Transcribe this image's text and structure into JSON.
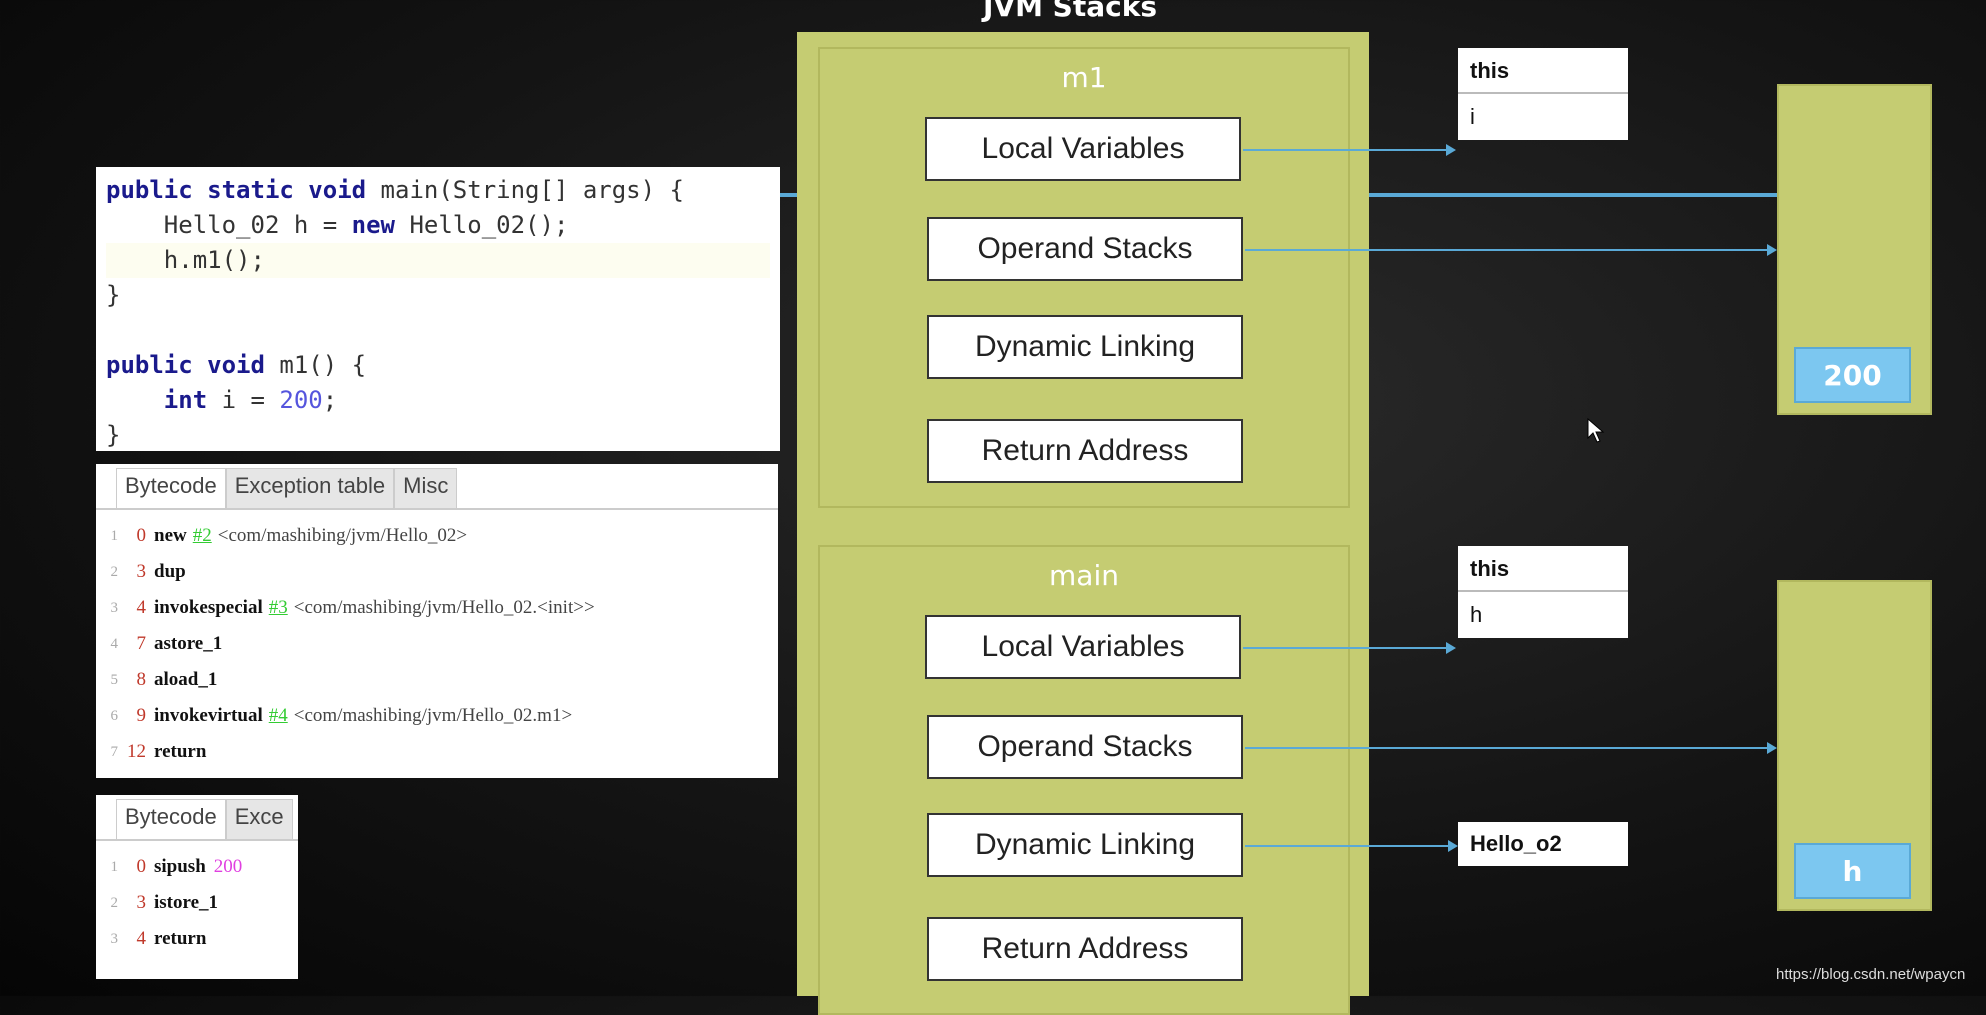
{
  "title": "JVM Stacks",
  "code": {
    "lines": [
      [
        {
          "t": "public static void",
          "c": "kw"
        },
        {
          "t": " main(String[] args) {"
        }
      ],
      [
        {
          "t": "    Hello_02 h = "
        },
        {
          "t": "new",
          "c": "kw"
        },
        {
          "t": " Hello_02();"
        }
      ],
      [
        {
          "t": "    h.m1();"
        }
      ],
      [
        {
          "t": "}"
        }
      ],
      [
        {
          "t": " "
        }
      ],
      [
        {
          "t": "public void",
          "c": "kw"
        },
        {
          "t": " m1() {"
        }
      ],
      [
        {
          "t": "    "
        },
        {
          "t": "int",
          "c": "kw"
        },
        {
          "t": " i = "
        },
        {
          "t": "200",
          "c": "num"
        },
        {
          "t": ";"
        }
      ],
      [
        {
          "t": "}"
        }
      ]
    ]
  },
  "bytecode_main": {
    "tabs": [
      "Bytecode",
      "Exception table",
      "Misc"
    ],
    "rows": [
      {
        "n": "1",
        "off": "0",
        "op": "new",
        "ref": "#2",
        "arg": "<com/mashibing/jvm/Hello_02>"
      },
      {
        "n": "2",
        "off": "3",
        "op": "dup"
      },
      {
        "n": "3",
        "off": "4",
        "op": "invokespecial",
        "ref": "#3",
        "arg": "<com/mashibing/jvm/Hello_02.<init>>"
      },
      {
        "n": "4",
        "off": "7",
        "op": "astore_1"
      },
      {
        "n": "5",
        "off": "8",
        "op": "aload_1"
      },
      {
        "n": "6",
        "off": "9",
        "op": "invokevirtual",
        "ref": "#4",
        "arg": "<com/mashibing/jvm/Hello_02.m1>"
      },
      {
        "n": "7",
        "off": "12",
        "op": "return"
      }
    ]
  },
  "bytecode_m1": {
    "tabs": [
      "Bytecode",
      "Exce"
    ],
    "rows": [
      {
        "n": "1",
        "off": "0",
        "op": "sipush",
        "val": "200"
      },
      {
        "n": "2",
        "off": "3",
        "op": "istore_1"
      },
      {
        "n": "3",
        "off": "4",
        "op": "return"
      }
    ]
  },
  "frames": [
    {
      "name": "m1",
      "items": [
        "Local Variables",
        "Operand Stacks",
        "Dynamic Linking",
        "Return Address"
      ],
      "locals": [
        "this",
        "i"
      ],
      "stack_value": "200"
    },
    {
      "name": "main",
      "items": [
        "Local Variables",
        "Operand Stacks",
        "Dynamic Linking",
        "Return Address"
      ],
      "locals": [
        "this",
        "h"
      ],
      "stack_value": "h",
      "dynamic_link": "Hello_o2"
    }
  ],
  "watermark": "https://blog.csdn.net/wpaycn",
  "colors": {
    "frame": "#c5cc72",
    "arrow": "#5aa9d6",
    "cell": "#7cc7f0"
  }
}
